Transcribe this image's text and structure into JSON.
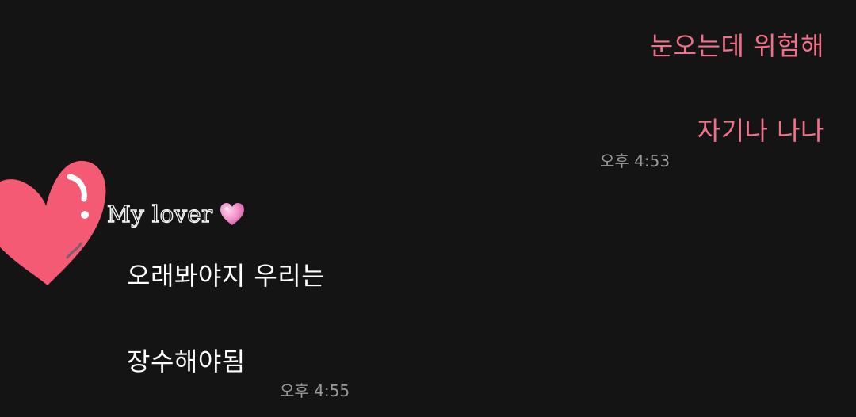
{
  "messages_mine": [
    {
      "text": "눈오는데 위험해"
    },
    {
      "text": "자기나 나나"
    }
  ],
  "time_mine": "오후 4:53",
  "sender": {
    "name": "My lover",
    "emoji_icon": "pink-heart-icon"
  },
  "avatar": {
    "icon": "heart-sticker-icon",
    "color": "#f45a73"
  },
  "messages_theirs": [
    {
      "text": "오래봐야지 우리는"
    },
    {
      "text": "장수해야됨"
    }
  ],
  "time_theirs": "오후 4:55",
  "colors": {
    "background": "#141414",
    "my_text": "#f2718a",
    "their_text": "#ffffff",
    "timestamp": "#9a9a9a"
  }
}
